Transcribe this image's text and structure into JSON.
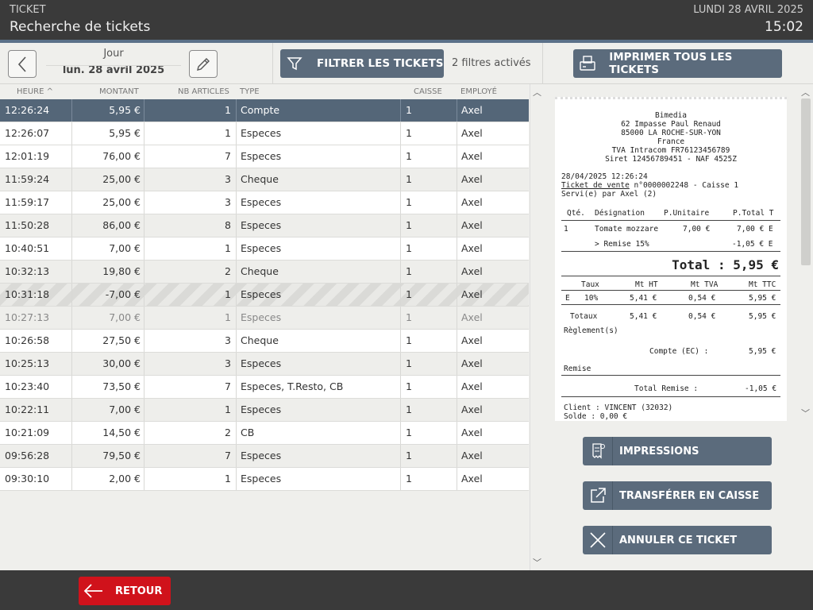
{
  "header": {
    "crumb": "TICKET",
    "title": "Recherche de tickets",
    "date": "LUNDI 28 AVRIL 2025",
    "time": "15:02"
  },
  "toolbar": {
    "day_label": "Jour",
    "day_value": "lun. 28 avril 2025",
    "filter_label": "FILTRER LES TICKETS",
    "filters_active": "2 filtres activés",
    "print_all_label": "IMPRIMER TOUS LES TICKETS"
  },
  "table": {
    "headers": [
      "HEURE ^",
      "MONTANT",
      "NB ARTICLES",
      "TYPE",
      "CAISSE",
      "EMPLOYÉ"
    ],
    "rows": [
      {
        "heure": "12:26:24",
        "montant": "5,95 €",
        "nb": "1",
        "type": "Compte",
        "caisse": "1",
        "employe": "Axel"
      },
      {
        "heure": "12:26:07",
        "montant": "5,95 €",
        "nb": "1",
        "type": "Especes",
        "caisse": "1",
        "employe": "Axel"
      },
      {
        "heure": "12:01:19",
        "montant": "76,00 €",
        "nb": "7",
        "type": "Especes",
        "caisse": "1",
        "employe": "Axel"
      },
      {
        "heure": "11:59:24",
        "montant": "25,00 €",
        "nb": "3",
        "type": "Cheque",
        "caisse": "1",
        "employe": "Axel"
      },
      {
        "heure": "11:59:17",
        "montant": "25,00 €",
        "nb": "3",
        "type": "Especes",
        "caisse": "1",
        "employe": "Axel"
      },
      {
        "heure": "11:50:28",
        "montant": "86,00 €",
        "nb": "8",
        "type": "Especes",
        "caisse": "1",
        "employe": "Axel"
      },
      {
        "heure": "10:40:51",
        "montant": "7,00 €",
        "nb": "1",
        "type": "Especes",
        "caisse": "1",
        "employe": "Axel"
      },
      {
        "heure": "10:32:13",
        "montant": "19,80 €",
        "nb": "2",
        "type": "Cheque",
        "caisse": "1",
        "employe": "Axel"
      },
      {
        "heure": "10:31:18",
        "montant": "-7,00 €",
        "nb": "1",
        "type": "Especes",
        "caisse": "1",
        "employe": "Axel"
      },
      {
        "heure": "10:27:13",
        "montant": "7,00 €",
        "nb": "1",
        "type": "Especes",
        "caisse": "1",
        "employe": "Axel"
      },
      {
        "heure": "10:26:58",
        "montant": "27,50 €",
        "nb": "3",
        "type": "Cheque",
        "caisse": "1",
        "employe": "Axel"
      },
      {
        "heure": "10:25:13",
        "montant": "30,00 €",
        "nb": "3",
        "type": "Especes",
        "caisse": "1",
        "employe": "Axel"
      },
      {
        "heure": "10:23:40",
        "montant": "73,50 €",
        "nb": "7",
        "type": "Especes, T.Resto, CB",
        "caisse": "1",
        "employe": "Axel"
      },
      {
        "heure": "10:22:11",
        "montant": "7,00 €",
        "nb": "1",
        "type": "Especes",
        "caisse": "1",
        "employe": "Axel"
      },
      {
        "heure": "10:21:09",
        "montant": "14,50 €",
        "nb": "2",
        "type": "CB",
        "caisse": "1",
        "employe": "Axel"
      },
      {
        "heure": "09:56:28",
        "montant": "79,50 €",
        "nb": "7",
        "type": "Especes",
        "caisse": "1",
        "employe": "Axel"
      },
      {
        "heure": "09:30:10",
        "montant": "2,00 €",
        "nb": "1",
        "type": "Especes",
        "caisse": "1",
        "employe": "Axel"
      }
    ]
  },
  "receipt": {
    "store": "Bimedia",
    "address1": "62 Impasse Paul Renaud",
    "address2": "85000 LA ROCHE-SUR-YON",
    "country": "France",
    "tva": "TVA Intracom FR76123456789",
    "siret": "Siret 12456789451 - NAF 4525Z",
    "datetime": "28/04/2025 12:26:24",
    "ticket_link": "Ticket de vente",
    "ticket_rest": " n°0000002248 - Caisse 1",
    "served": "Servi(e) par Axel (2)",
    "col_qty": "Qté.",
    "col_desig": "Désignation",
    "col_pu": "P.Unitaire",
    "col_pt": "P.Total T",
    "item_qty": "1",
    "item_name": "Tomate mozzare",
    "item_pu": "7,00 €",
    "item_pt": "7,00 € E",
    "discount_label": "> Remise 15%",
    "discount_value": "-1,05 € E",
    "total": "Total : 5,95 €",
    "tax_taux": "Taux",
    "tax_ht": "Mt HT",
    "tax_tva": "Mt TVA",
    "tax_ttc": "Mt TTC",
    "tax_row_code": "E",
    "tax_row_rate": "10%",
    "tax_row_ht": "5,41 €",
    "tax_row_tva": "0,54 €",
    "tax_row_ttc": "5,95 €",
    "totaux_label": "Totaux",
    "totaux_ht": "5,41 €",
    "totaux_tva": "0,54 €",
    "totaux_ttc": "5,95 €",
    "reglement": "Règlement(s)",
    "compte_label": "Compte (EC) :",
    "compte_value": "5,95 €",
    "remise": "Remise",
    "total_remise_label": "Total Remise :",
    "total_remise_value": "-1,05 €",
    "client": "Client : VINCENT (32032)",
    "solde": "Solde : 0,00 €"
  },
  "actions": {
    "impressions": "IMPRESSIONS",
    "transferer": "TRANSFÉRER EN CAISSE",
    "annuler": "ANNULER CE TICKET"
  },
  "footer": {
    "back_label": "RETOUR"
  },
  "colors": {
    "header_bg": "#3a3a3a",
    "accent": "#5b6b7c",
    "selected_row": "#546678",
    "back_button": "#d0121b"
  }
}
